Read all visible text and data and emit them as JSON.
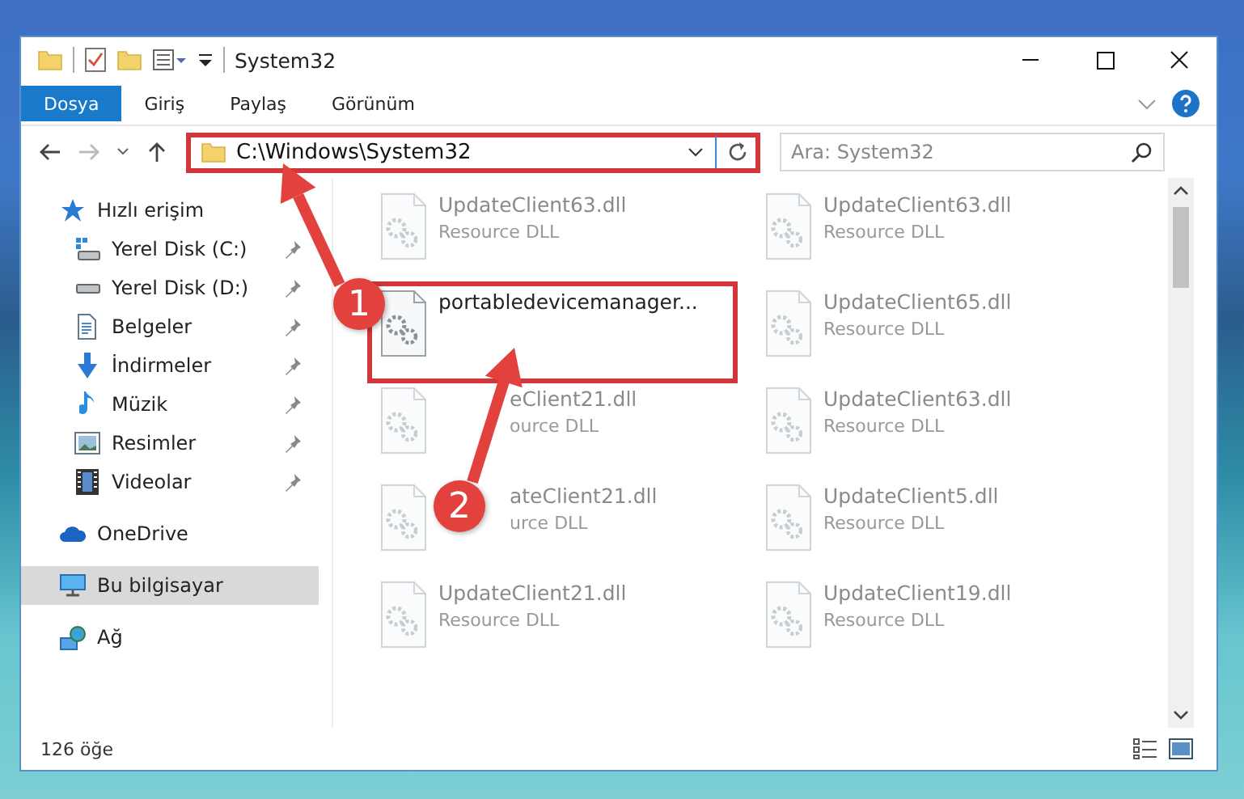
{
  "window": {
    "title": "System32"
  },
  "ribbon": {
    "tabs": [
      {
        "label": "Dosya",
        "selected": true
      },
      {
        "label": "Giriş",
        "selected": false
      },
      {
        "label": "Paylaş",
        "selected": false
      },
      {
        "label": "Görünüm",
        "selected": false
      }
    ]
  },
  "address": {
    "path": "C:\\Windows\\System32",
    "highlighted": true
  },
  "search": {
    "placeholder": "Ara: System32"
  },
  "sidebar": {
    "items": [
      {
        "label": "Hızlı erişim",
        "kind": "star",
        "pinned": false,
        "selected": false
      },
      {
        "label": "Yerel Disk (C:)",
        "kind": "sysdisk",
        "pinned": true,
        "selected": false
      },
      {
        "label": "Yerel Disk (D:)",
        "kind": "disk",
        "pinned": true,
        "selected": false
      },
      {
        "label": "Belgeler",
        "kind": "docs",
        "pinned": true,
        "selected": false
      },
      {
        "label": "İndirmeler",
        "kind": "download",
        "pinned": true,
        "selected": false
      },
      {
        "label": "Müzik",
        "kind": "music",
        "pinned": true,
        "selected": false
      },
      {
        "label": "Resimler",
        "kind": "pictures",
        "pinned": true,
        "selected": false
      },
      {
        "label": "Videolar",
        "kind": "videos",
        "pinned": true,
        "selected": false
      },
      {
        "label": "OneDrive",
        "kind": "cloud",
        "pinned": false,
        "selected": false
      },
      {
        "label": "Bu bilgisayar",
        "kind": "pc",
        "pinned": false,
        "selected": true
      },
      {
        "label": "Ağ",
        "kind": "network",
        "pinned": false,
        "selected": false
      }
    ]
  },
  "files": [
    {
      "name": "UpdateClient63.dll",
      "type": "Resource DLL",
      "faded": true,
      "highlighted": false,
      "partly_hidden": false
    },
    {
      "name": "UpdateClient63.dll",
      "type": "Resource DLL",
      "faded": true,
      "highlighted": false,
      "partly_hidden": false
    },
    {
      "name": "portabledevicemanager...",
      "faded": false,
      "highlighted": true,
      "partly_hidden": false
    },
    {
      "name": "UpdateClient65.dll",
      "type": "Resource DLL",
      "faded": true,
      "highlighted": false,
      "partly_hidden": false
    },
    {
      "name": "eClient21.dll",
      "type": "ource DLL",
      "faded": true,
      "highlighted": false,
      "partly_hidden": true
    },
    {
      "name": "UpdateClient63.dll",
      "type": "Resource DLL",
      "faded": true,
      "highlighted": false,
      "partly_hidden": false
    },
    {
      "name": "ateClient21.dll",
      "type": "urce DLL",
      "faded": true,
      "highlighted": false,
      "partly_hidden": true
    },
    {
      "name": "UpdateClient5.dll",
      "type": "Resource DLL",
      "faded": true,
      "highlighted": false,
      "partly_hidden": false
    },
    {
      "name": "UpdateClient21.dll",
      "type": "Resource DLL",
      "faded": true,
      "highlighted": false,
      "partly_hidden": false
    },
    {
      "name": "UpdateClient19.dll",
      "type": "Resource DLL",
      "faded": true,
      "highlighted": false,
      "partly_hidden": false
    }
  ],
  "status_bar": {
    "count": "126 öğe"
  },
  "annotations": {
    "steps": [
      "1",
      "2"
    ]
  }
}
